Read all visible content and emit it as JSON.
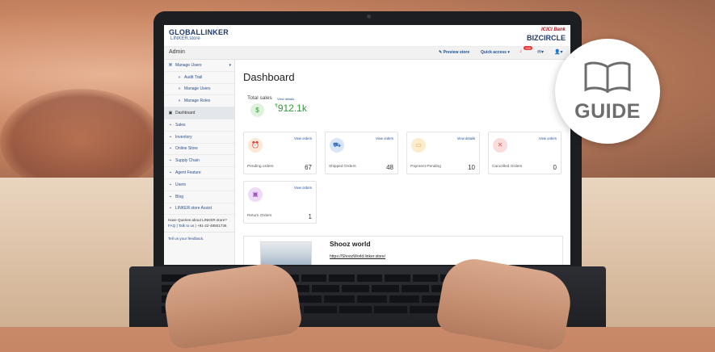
{
  "header": {
    "logo_main": "GLOBALLINKER",
    "logo_sub": "LINKER.store",
    "bank_name": "ICICI Bank",
    "bank_brand": "BIZCIRCLE"
  },
  "topbar": {
    "title": "Admin",
    "preview_store": "Preview store",
    "quick_access": "Quick access",
    "notification_count": "146"
  },
  "sidebar": {
    "items": [
      {
        "label": "Manage Users",
        "glyph": "⌘",
        "sub": false
      },
      {
        "label": "Audit Trail",
        "glyph": "»",
        "sub": true
      },
      {
        "label": "Manage Users",
        "glyph": "»",
        "sub": true
      },
      {
        "label": "Manage Roles",
        "glyph": "»",
        "sub": true
      },
      {
        "label": "Dashboard",
        "glyph": "",
        "sub": false
      },
      {
        "label": "Sales",
        "glyph": "▪",
        "sub": false
      },
      {
        "label": "Inventory",
        "glyph": "▪",
        "sub": false
      },
      {
        "label": "Online Store",
        "glyph": "▪",
        "sub": false
      },
      {
        "label": "Supply Chain",
        "glyph": "▪",
        "sub": false
      },
      {
        "label": "Agent Feature",
        "glyph": "▪",
        "sub": false
      },
      {
        "label": "Users",
        "glyph": "▪",
        "sub": false
      },
      {
        "label": "Blog",
        "glyph": "▪",
        "sub": false
      },
      {
        "label": "LINKER.store Assist",
        "glyph": "•",
        "sub": false
      }
    ],
    "help_text": "Have Queries about LINKER.store?",
    "help_faq": "FAQ",
    "help_talk": "Talk to us",
    "help_phone": "+91-22-48501736",
    "feedback": "Tell us your feedback."
  },
  "main": {
    "title": "Dashboard",
    "total_sales_label": "Total sales",
    "total_sales_view": "View details",
    "total_sales_currency": "₹",
    "total_sales_value": "912.1k",
    "cards": [
      {
        "label": "Pending orders",
        "view": "View orders",
        "count": "67",
        "icon": "alarm-clock-icon",
        "glyph": "⏰",
        "color": "#f0a35a",
        "bg": "#fde8d6"
      },
      {
        "label": "Shipped Orders",
        "view": "View orders",
        "count": "48",
        "icon": "truck-icon",
        "glyph": "🚚",
        "color": "#3b74c7",
        "bg": "#d9e6f7"
      },
      {
        "label": "Payment Pending",
        "view": "View details",
        "count": "10",
        "icon": "payment-card-icon",
        "glyph": "💳",
        "color": "#e8a53b",
        "bg": "#fbeccc"
      },
      {
        "label": "Cancelled Orders",
        "view": "View orders",
        "count": "0",
        "icon": "cart-cancel-icon",
        "glyph": "🛒",
        "color": "#e05454",
        "bg": "#fbdcdc"
      },
      {
        "label": "Return Orders",
        "view": "View orders",
        "count": "1",
        "icon": "return-box-icon",
        "glyph": "📦",
        "color": "#a155c7",
        "bg": "#eedcf7"
      }
    ],
    "store": {
      "name": "Shooz world",
      "url": "https://ShoozWorld.linker.store/"
    }
  },
  "guide": {
    "label": "GUIDE"
  }
}
